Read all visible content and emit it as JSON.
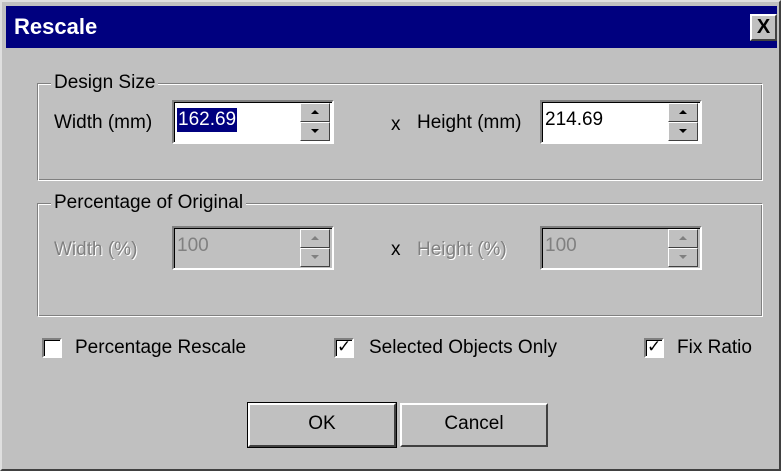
{
  "window": {
    "title": "Rescale",
    "close_label": "X"
  },
  "design_size": {
    "group_label": "Design Size",
    "width_label": "Width (mm)",
    "width_value": "162.69",
    "separator": "x",
    "height_label": "Height (mm)",
    "height_value": "214.69"
  },
  "percentage": {
    "group_label": "Percentage of Original",
    "width_label": "Width (%)",
    "width_value": "100",
    "separator": "x",
    "height_label": "Height (%)",
    "height_value": "100"
  },
  "options": {
    "percentage_rescale": {
      "label": "Percentage Rescale",
      "checked": false
    },
    "selected_only": {
      "label": "Selected Objects Only",
      "checked": true
    },
    "fix_ratio": {
      "label": "Fix Ratio",
      "checked": true
    }
  },
  "buttons": {
    "ok": "OK",
    "cancel": "Cancel"
  },
  "colors": {
    "titlebar": "#00007f",
    "face": "#c0c0c0",
    "selection": "#00007f"
  }
}
